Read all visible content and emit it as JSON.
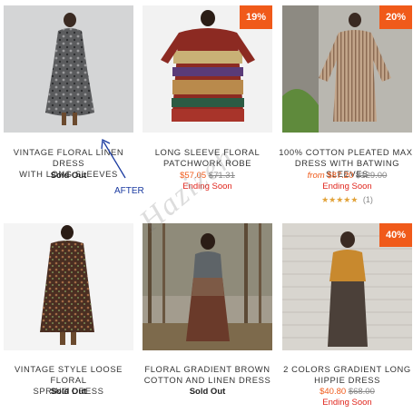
{
  "products": [
    {
      "title_line1": "VINTAGE FLORAL LINEN DRESS",
      "title_line2": "WITH LONG SLEEVES",
      "status": "Sold Out"
    },
    {
      "title_line1": "LONG SLEEVE FLORAL",
      "title_line2": "PATCHWORK ROBE",
      "badge": "19%",
      "sale_price": "$57.05",
      "old_price": "$71.31",
      "status": "Ending Soon"
    },
    {
      "title_line1": "100% COTTON PLEATED MAXI",
      "title_line2": "DRESS WITH BATWING SLEEVES",
      "badge": "20%",
      "from_label": "from",
      "sale_price": "$87.20",
      "old_price": "$129.00",
      "status": "Ending Soon",
      "stars": "★★★★★",
      "review_count": "(1)"
    },
    {
      "title_line1": "VINTAGE STYLE LOOSE FLORAL",
      "title_line2": "SPRING DRESS",
      "status": "Sold Out"
    },
    {
      "title_line1": "FLORAL GRADIENT BROWN",
      "title_line2": "COTTON AND LINEN DRESS",
      "status": "Sold Out"
    },
    {
      "title_line1": "2 COLORS GRADIENT LONG",
      "title_line2": "HIPPIE DRESS",
      "badge": "40%",
      "sale_price": "$40.80",
      "old_price": "$68.00",
      "status": "Ending Soon"
    }
  ],
  "annotation": {
    "label": "AFTER"
  },
  "watermark": "Hazizeh",
  "colors": {
    "badge": "#f05a1a",
    "sale": "#f05a1a",
    "ending": "#e0261d",
    "star": "#e2a33a"
  }
}
